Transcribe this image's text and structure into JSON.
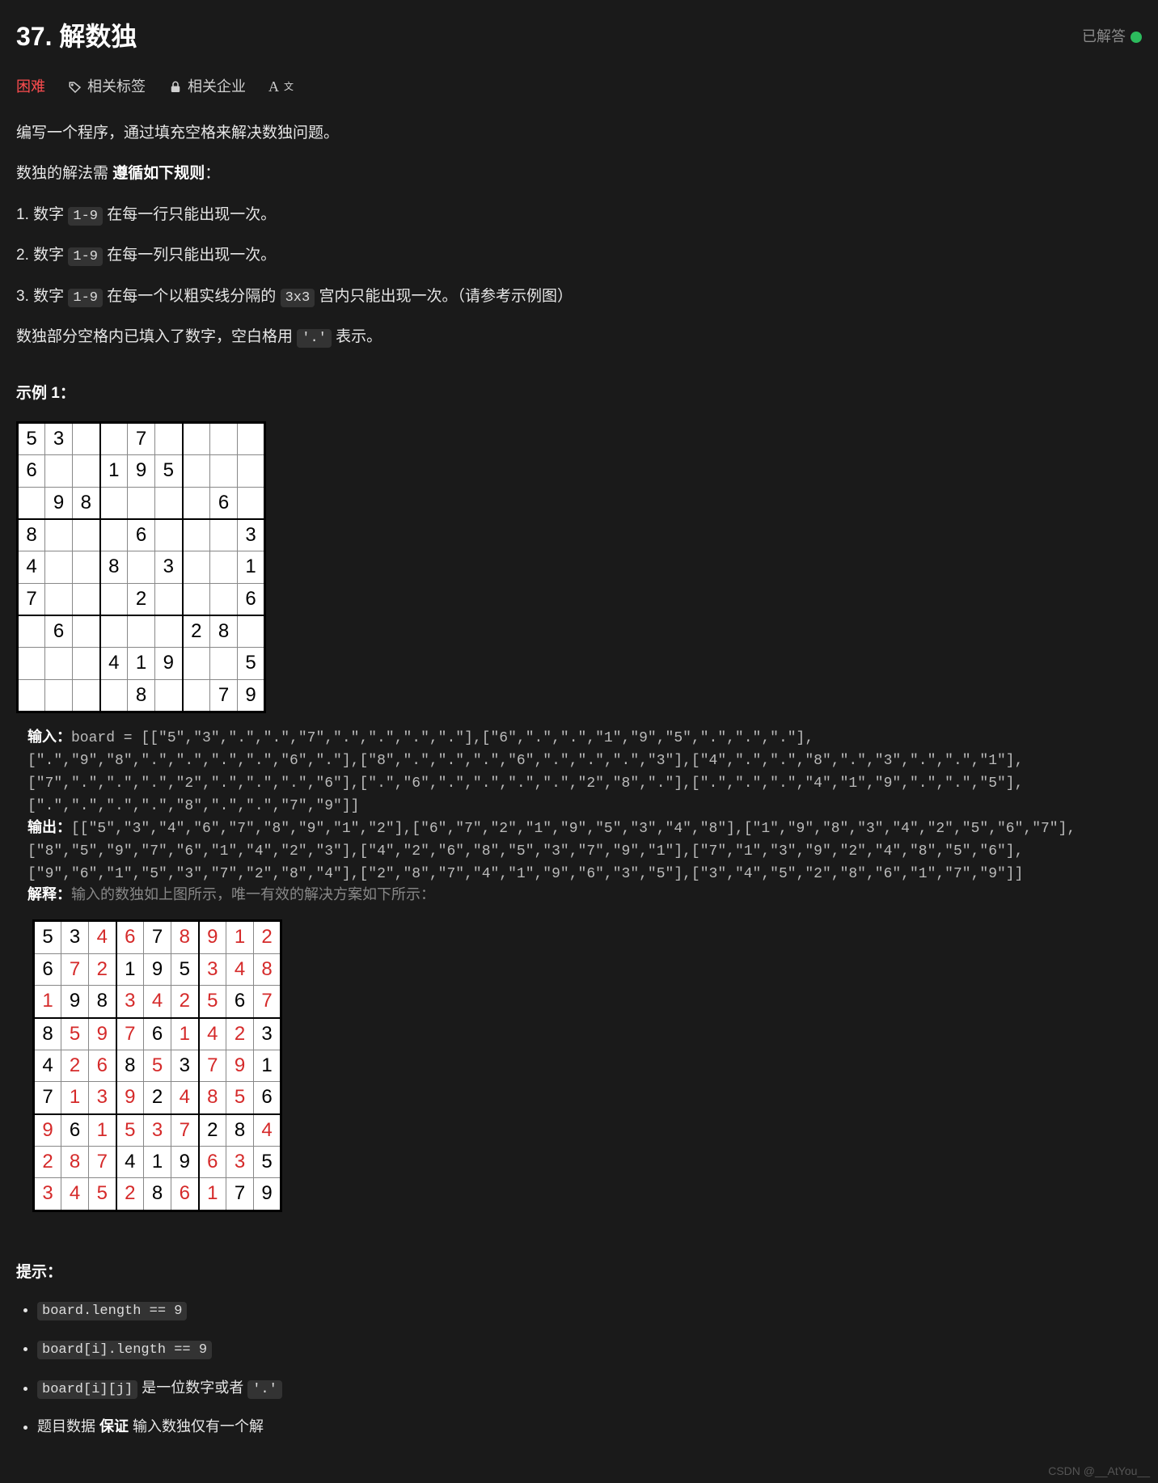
{
  "header": {
    "title": "37. 解数独",
    "solved_label": "已解答"
  },
  "tabs": {
    "difficulty": "困难",
    "tags": "相关标签",
    "companies": "相关企业",
    "fontsize": "A"
  },
  "desc": {
    "intro": "编写一个程序，通过填充空格来解决数独问题。",
    "rules_intro_pre": "数独的解法需 ",
    "rules_intro_b": "遵循如下规则",
    "rules_intro_post": "：",
    "rule1_pre": "1. 数字 ",
    "rule1_code": "1-9",
    "rule1_post": " 在每一行只能出现一次。",
    "rule2_pre": "2. 数字 ",
    "rule2_code": "1-9",
    "rule2_post": " 在每一列只能出现一次。",
    "rule3_pre": "3. 数字 ",
    "rule3_code": "1-9",
    "rule3_mid": " 在每一个以粗实线分隔的 ",
    "rule3_code2": "3x3",
    "rule3_post": " 宫内只能出现一次。（请参考示例图）",
    "note_pre": "数独部分空格内已填入了数字，空白格用 ",
    "note_code": "'.'",
    "note_post": " 表示。"
  },
  "example": {
    "label": "示例 1：",
    "input_label": "输入：",
    "input_text": "board = [[\"5\",\"3\",\".\",\".\",\"7\",\".\",\".\",\".\",\".\"],[\"6\",\".\",\".\",\"1\",\"9\",\"5\",\".\",\".\",\".\"],[\".\",\"9\",\"8\",\".\",\".\",\".\",\".\",\"6\",\".\"],[\"8\",\".\",\".\",\".\",\"6\",\".\",\".\",\".\",\"3\"],[\"4\",\".\",\".\",\"8\",\".\",\"3\",\".\",\".\",\"1\"],[\"7\",\".\",\".\",\".\",\"2\",\".\",\".\",\".\",\"6\"],[\".\",\"6\",\".\",\".\",\".\",\".\",\"2\",\"8\",\".\"],[\".\",\".\",\".\",\"4\",\"1\",\"9\",\".\",\".\",\"5\"],[\".\",\".\",\".\",\".\",\"8\",\".\",\".\",\"7\",\"9\"]]",
    "output_label": "输出：",
    "output_text": "[[\"5\",\"3\",\"4\",\"6\",\"7\",\"8\",\"9\",\"1\",\"2\"],[\"6\",\"7\",\"2\",\"1\",\"9\",\"5\",\"3\",\"4\",\"8\"],[\"1\",\"9\",\"8\",\"3\",\"4\",\"2\",\"5\",\"6\",\"7\"],[\"8\",\"5\",\"9\",\"7\",\"6\",\"1\",\"4\",\"2\",\"3\"],[\"4\",\"2\",\"6\",\"8\",\"5\",\"3\",\"7\",\"9\",\"1\"],[\"7\",\"1\",\"3\",\"9\",\"2\",\"4\",\"8\",\"5\",\"6\"],[\"9\",\"6\",\"1\",\"5\",\"3\",\"7\",\"2\",\"8\",\"4\"],[\"2\",\"8\",\"7\",\"4\",\"1\",\"9\",\"6\",\"3\",\"5\"],[\"3\",\"4\",\"5\",\"2\",\"8\",\"6\",\"1\",\"7\",\"9\"]]",
    "explain_label": "解释：",
    "explain_text": "输入的数独如上图所示，唯一有效的解决方案如下所示："
  },
  "sudoku_input": [
    [
      "5",
      "3",
      "",
      "",
      "7",
      "",
      "",
      "",
      ""
    ],
    [
      "6",
      "",
      "",
      "1",
      "9",
      "5",
      "",
      "",
      ""
    ],
    [
      "",
      "9",
      "8",
      "",
      "",
      "",
      "",
      "6",
      ""
    ],
    [
      "8",
      "",
      "",
      "",
      "6",
      "",
      "",
      "",
      "3"
    ],
    [
      "4",
      "",
      "",
      "8",
      "",
      "3",
      "",
      "",
      "1"
    ],
    [
      "7",
      "",
      "",
      "",
      "2",
      "",
      "",
      "",
      "6"
    ],
    [
      "",
      "6",
      "",
      "",
      "",
      "",
      "2",
      "8",
      ""
    ],
    [
      "",
      "",
      "",
      "4",
      "1",
      "9",
      "",
      "",
      "5"
    ],
    [
      "",
      "",
      "",
      "",
      "8",
      "",
      "",
      "7",
      "9"
    ]
  ],
  "sudoku_output": [
    [
      "5",
      "3",
      "4",
      "6",
      "7",
      "8",
      "9",
      "1",
      "2"
    ],
    [
      "6",
      "7",
      "2",
      "1",
      "9",
      "5",
      "3",
      "4",
      "8"
    ],
    [
      "1",
      "9",
      "8",
      "3",
      "4",
      "2",
      "5",
      "6",
      "7"
    ],
    [
      "8",
      "5",
      "9",
      "7",
      "6",
      "1",
      "4",
      "2",
      "3"
    ],
    [
      "4",
      "2",
      "6",
      "8",
      "5",
      "3",
      "7",
      "9",
      "1"
    ],
    [
      "7",
      "1",
      "3",
      "9",
      "2",
      "4",
      "8",
      "5",
      "6"
    ],
    [
      "9",
      "6",
      "1",
      "5",
      "3",
      "7",
      "2",
      "8",
      "4"
    ],
    [
      "2",
      "8",
      "7",
      "4",
      "1",
      "9",
      "6",
      "3",
      "5"
    ],
    [
      "3",
      "4",
      "5",
      "2",
      "8",
      "6",
      "1",
      "7",
      "9"
    ]
  ],
  "hints": {
    "label": "提示：",
    "items": [
      {
        "code1": "board.length == 9"
      },
      {
        "code1": "board[i].length == 9"
      },
      {
        "code1": "board[i][j]",
        "txt1": " 是一位数字或者 ",
        "code2": "'.'"
      },
      {
        "txt1": "题目数据 ",
        "b1": "保证",
        "txt2": " 输入数独仅有一个解"
      }
    ]
  },
  "watermark": "CSDN @__AtYou__"
}
